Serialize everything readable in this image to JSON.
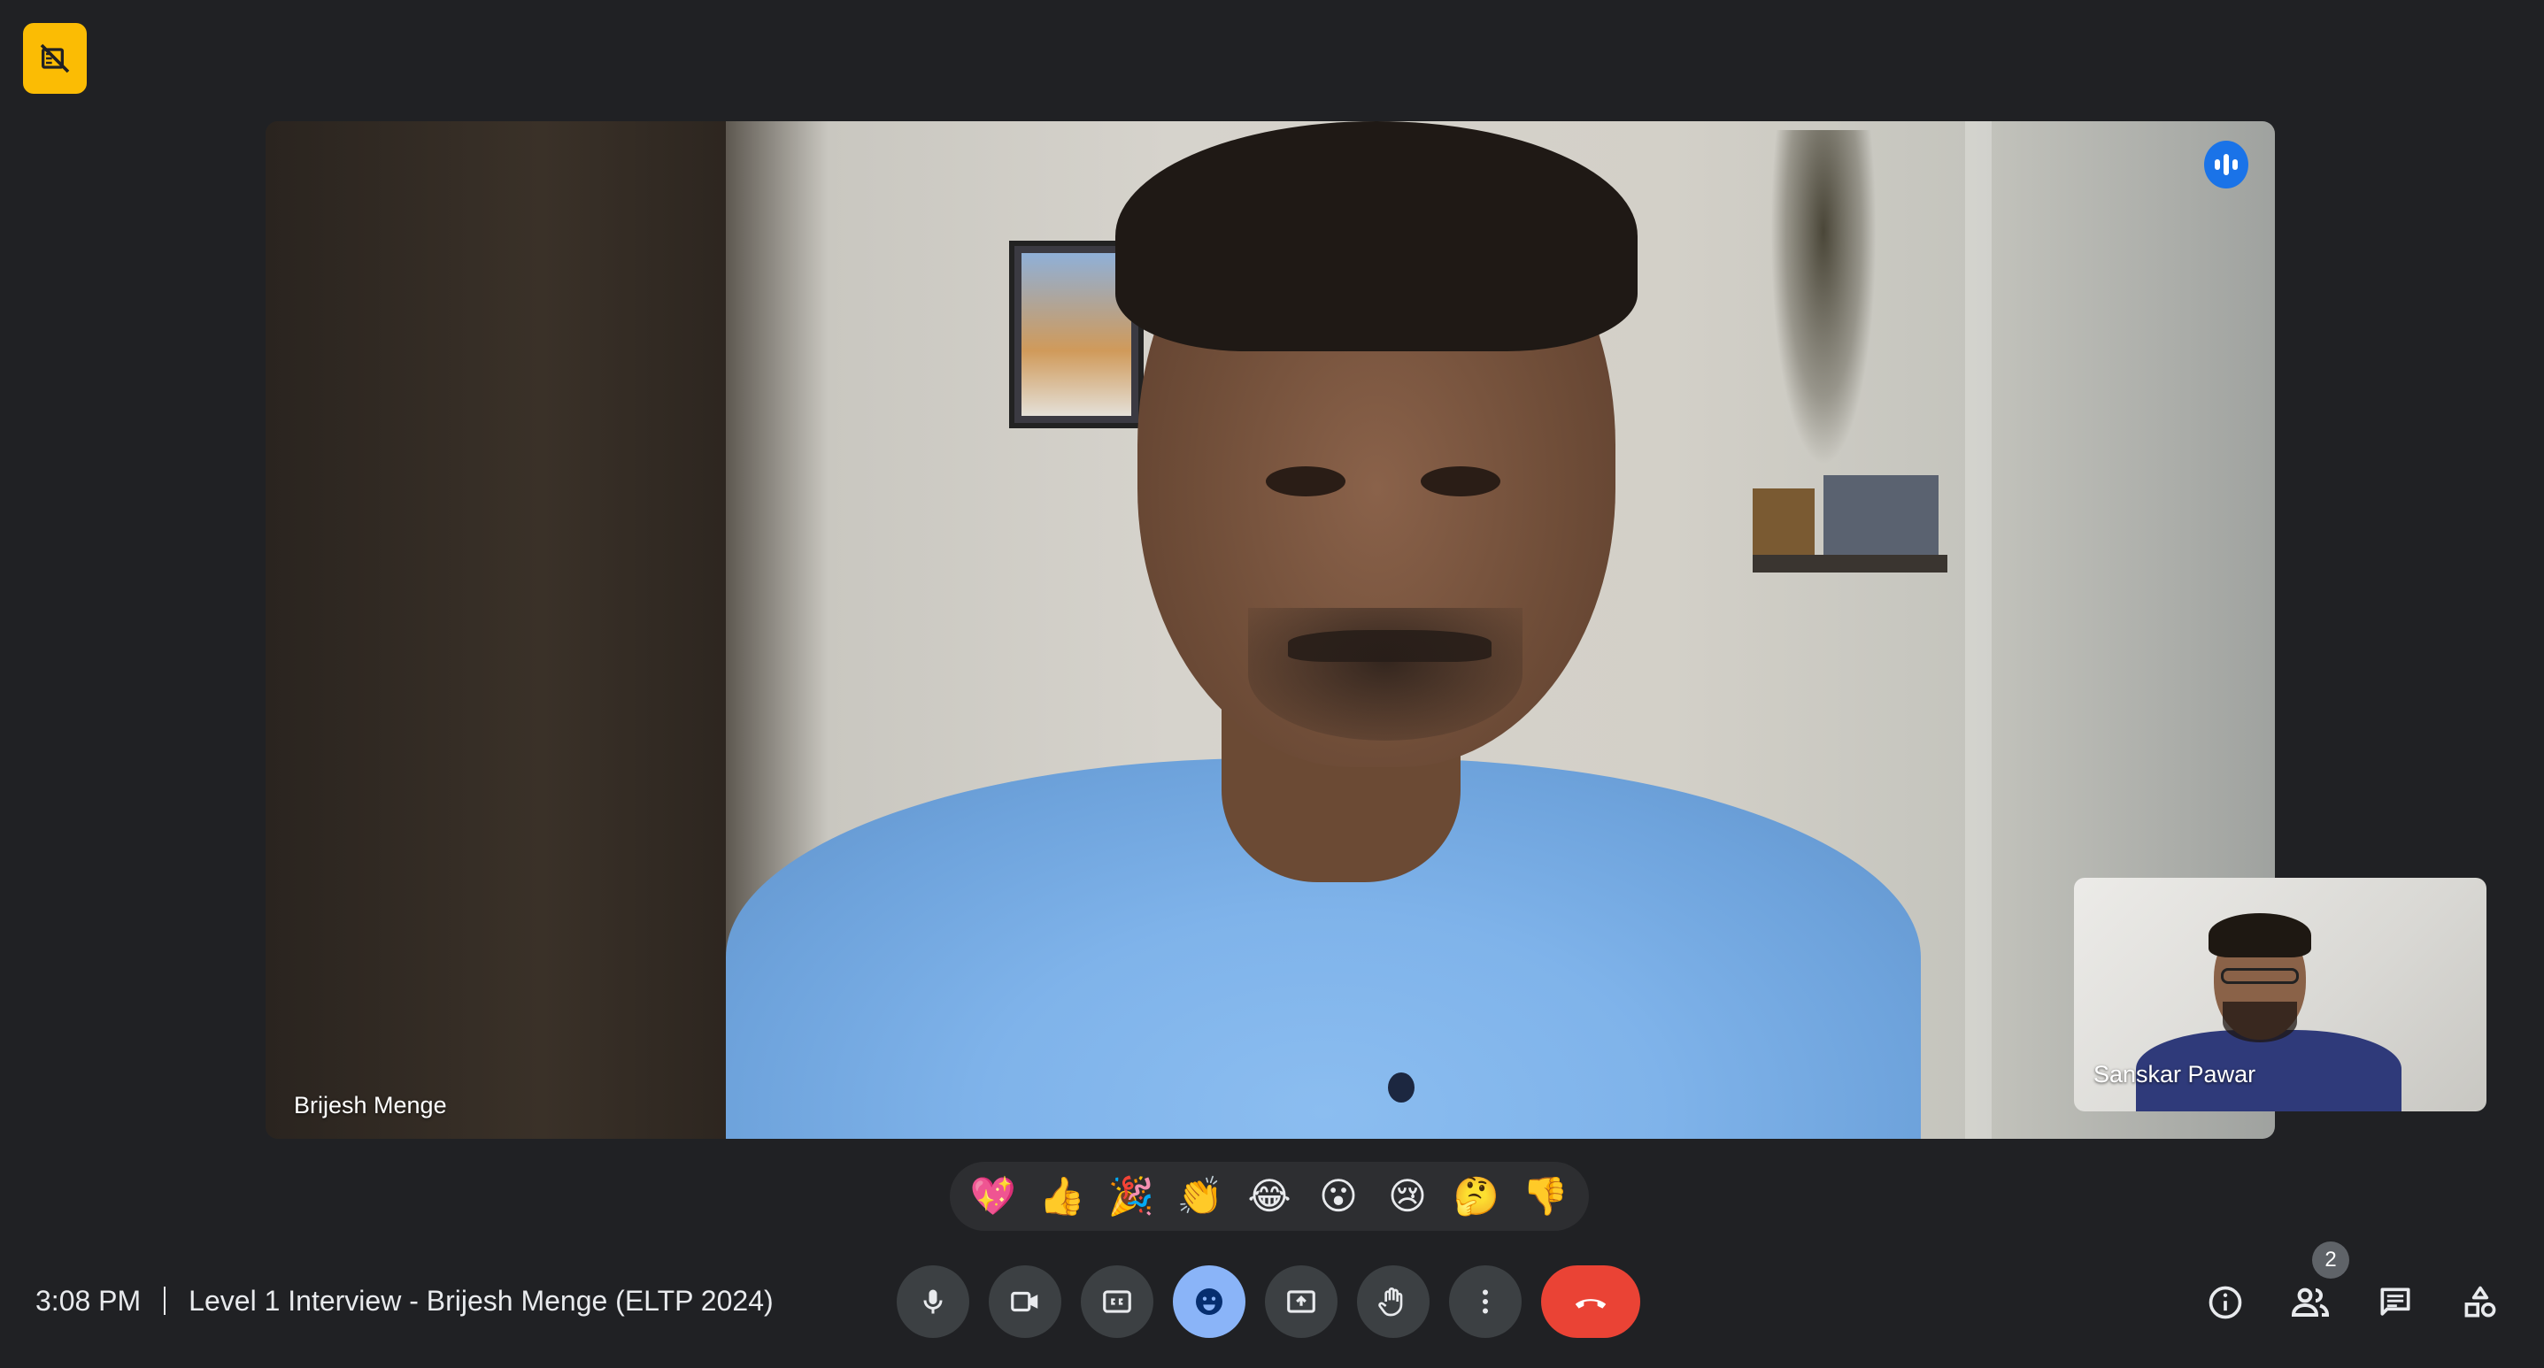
{
  "meeting": {
    "time": "3:08 PM",
    "title": "Level 1 Interview - Brijesh Menge (ELTP 2024)"
  },
  "participants": {
    "main": {
      "name": "Brijesh Menge",
      "speaking": true
    },
    "self": {
      "name": "Sanskar Pawar"
    },
    "count": "2"
  },
  "reactions": [
    "💖",
    "👍",
    "🎉",
    "👏",
    "😂",
    "😮",
    "😢",
    "🤔",
    "👎"
  ],
  "controls": {
    "mic": "microphone-icon",
    "camera": "camera-icon",
    "captions": "closed-captions-icon",
    "reactions": "emoji-icon",
    "present": "present-screen-icon",
    "raise_hand": "raise-hand-icon",
    "more": "more-options-icon",
    "leave": "leave-call-icon"
  },
  "side_controls": {
    "info": "info-icon",
    "people": "people-icon",
    "chat": "chat-icon",
    "activities": "activities-icon"
  },
  "colors": {
    "background": "#202124",
    "recording_indicator": "#fbbc04",
    "active_control": "#8ab4f8",
    "hangup": "#ea4335",
    "speaking_indicator": "#1a73e8"
  }
}
